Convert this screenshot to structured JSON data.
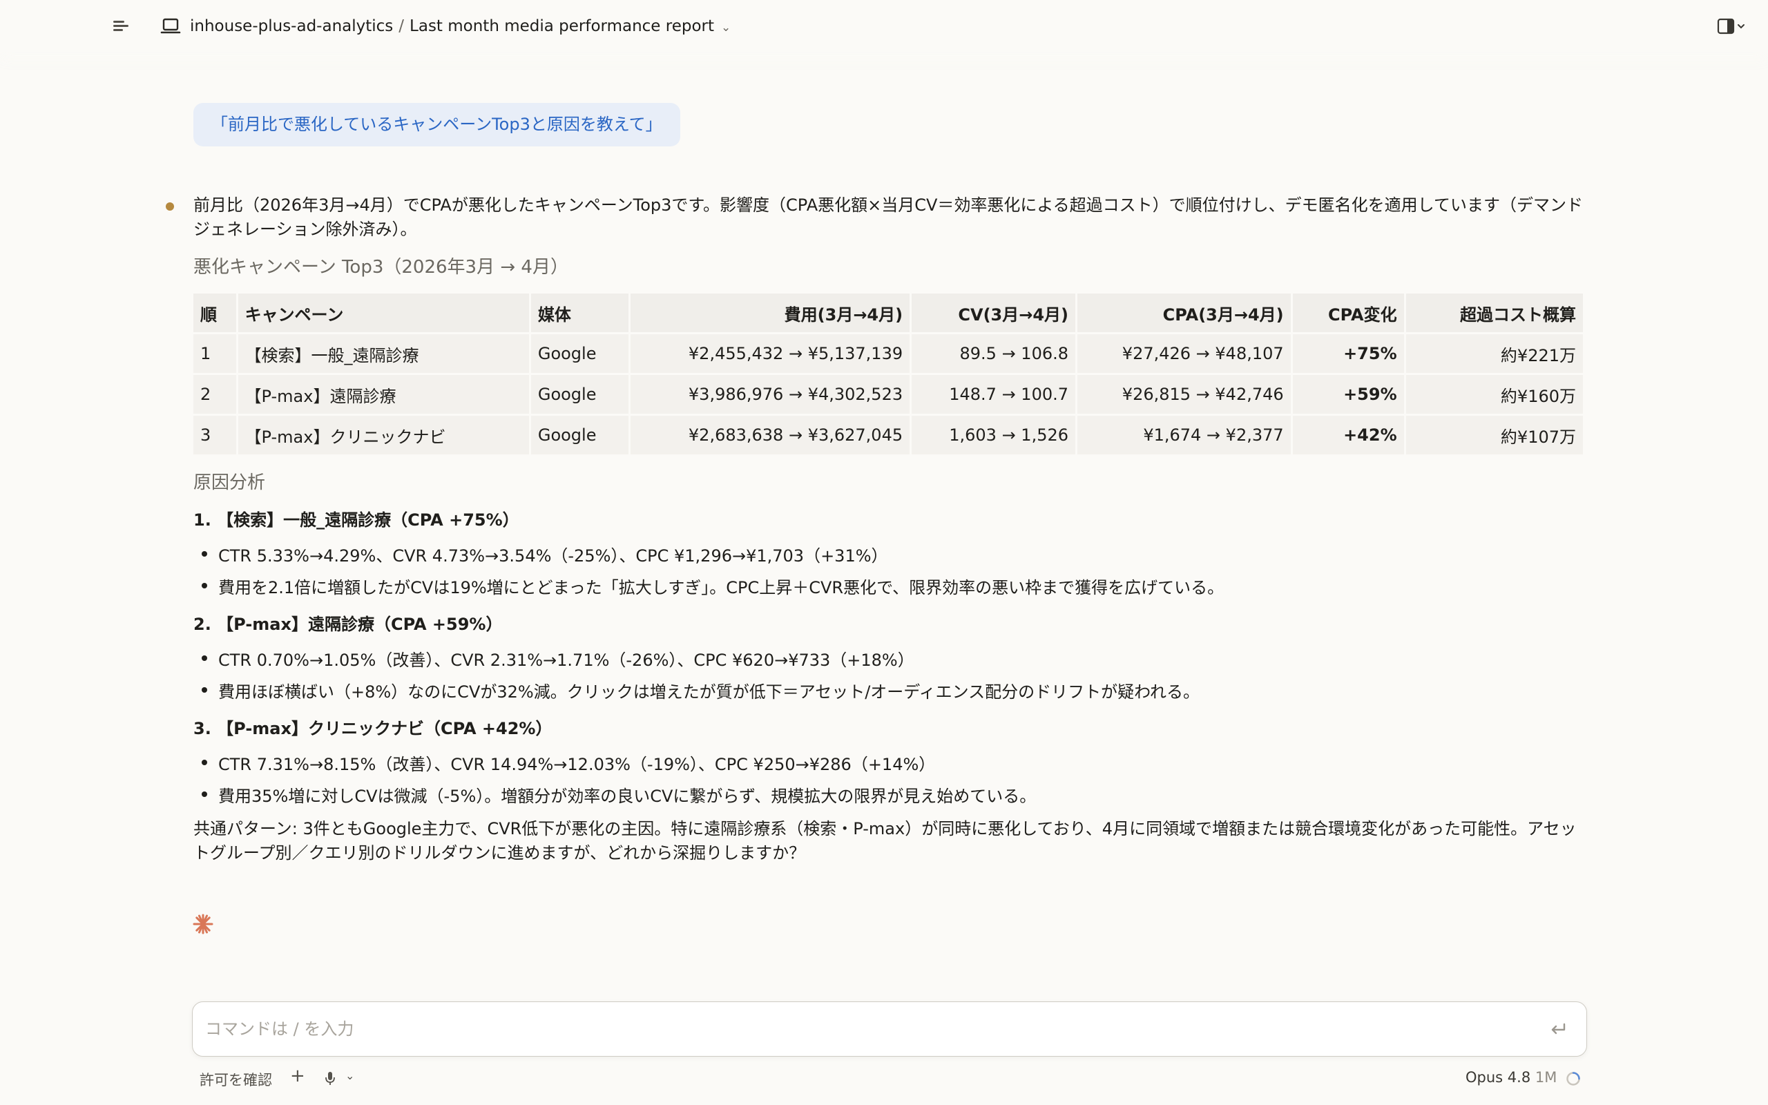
{
  "header": {
    "project": "inhouse-plus-ad-analytics",
    "separator": "/",
    "title": "Last month media performance report",
    "chevron": "⌄",
    "icons": [
      "menu-icon",
      "laptop-icon",
      "chevron-down-icon",
      "panel-toggle-icon"
    ]
  },
  "user_message": "「前月比で悪化しているキャンペーンTop3と原因を教えて」",
  "assistant": {
    "intro": "前月比（2026年3月→4月）でCPAが悪化したキャンペーンTop3です。影響度（CPA悪化額×当月CV＝効率悪化による超過コスト）で順位付けし、デモ匿名化を適用しています（デマンドジェネレーション除外済み）。",
    "table_title": "悪化キャンペーン Top3（2026年3月 → 4月）",
    "table": {
      "headers": [
        "順",
        "キャンペーン",
        "媒体",
        "費用(3月→4月)",
        "CV(3月→4月)",
        "CPA(3月→4月)",
        "CPA変化",
        "超過コスト概算"
      ],
      "rows": [
        [
          "1",
          "【検索】一般_遠隔診療",
          "Google",
          "¥2,455,432 → ¥5,137,139",
          "89.5 → 106.8",
          "¥27,426 → ¥48,107",
          "+75%",
          "約¥221万"
        ],
        [
          "2",
          "【P-max】遠隔診療",
          "Google",
          "¥3,986,976 → ¥4,302,523",
          "148.7 → 100.7",
          "¥26,815 → ¥42,746",
          "+59%",
          "約¥160万"
        ],
        [
          "3",
          "【P-max】クリニックナビ",
          "Google",
          "¥2,683,638 → ¥3,627,045",
          "1,603 → 1,526",
          "¥1,674 → ¥2,377",
          "+42%",
          "約¥107万"
        ]
      ]
    },
    "analysis_title": "原因分析",
    "sections": [
      {
        "title": "1. 【検索】一般_遠隔診療（CPA +75%）",
        "bullets": [
          "CTR 5.33%→4.29%、CVR 4.73%→3.54%（-25%）、CPC ¥1,296→¥1,703（+31%）",
          "費用を2.1倍に増額したがCVは19%増にとどまった「拡大しすぎ」。CPC上昇＋CVR悪化で、限界効率の悪い枠まで獲得を広げている。"
        ]
      },
      {
        "title": "2. 【P-max】遠隔診療（CPA +59%）",
        "bullets": [
          "CTR 0.70%→1.05%（改善）、CVR 2.31%→1.71%（-26%）、CPC ¥620→¥733（+18%）",
          "費用ほぼ横ばい（+8%）なのにCVが32%減。クリックは増えたが質が低下＝アセット/オーディエンス配分のドリフトが疑われる。"
        ]
      },
      {
        "title": "3. 【P-max】クリニックナビ（CPA +42%）",
        "bullets": [
          "CTR 7.31%→8.15%（改善）、CVR 14.94%→12.03%（-19%）、CPC ¥250→¥286（+14%）",
          "費用35%増に対しCVは微減（-5%）。増額分が効率の良いCVに繋がらず、規模拡大の限界が見え始めている。"
        ]
      }
    ],
    "summary": "共通パターン: 3件ともGoogle主力で、CVR低下が悪化の主因。特に遠隔診療系（検索・P-max）が同時に悪化しており、4月に同領域で増額または競合環境変化があった可能性。アセットグループ別／クエリ別のドリルダウンに進めますが、どれから深掘りしますか？"
  },
  "input": {
    "placeholder": "コマンドは / を入力",
    "value": ""
  },
  "footer": {
    "permission_label": "許可を確認",
    "plus": "+",
    "mic_chevron": "⌄",
    "model": "Opus 4.8",
    "context": "1M"
  },
  "colors": {
    "background": "#fbfaf7",
    "bubble_bg": "#e8eef8",
    "bubble_text": "#2a66c4",
    "accent_spark": "#d97757",
    "dot": "#b5893f"
  }
}
